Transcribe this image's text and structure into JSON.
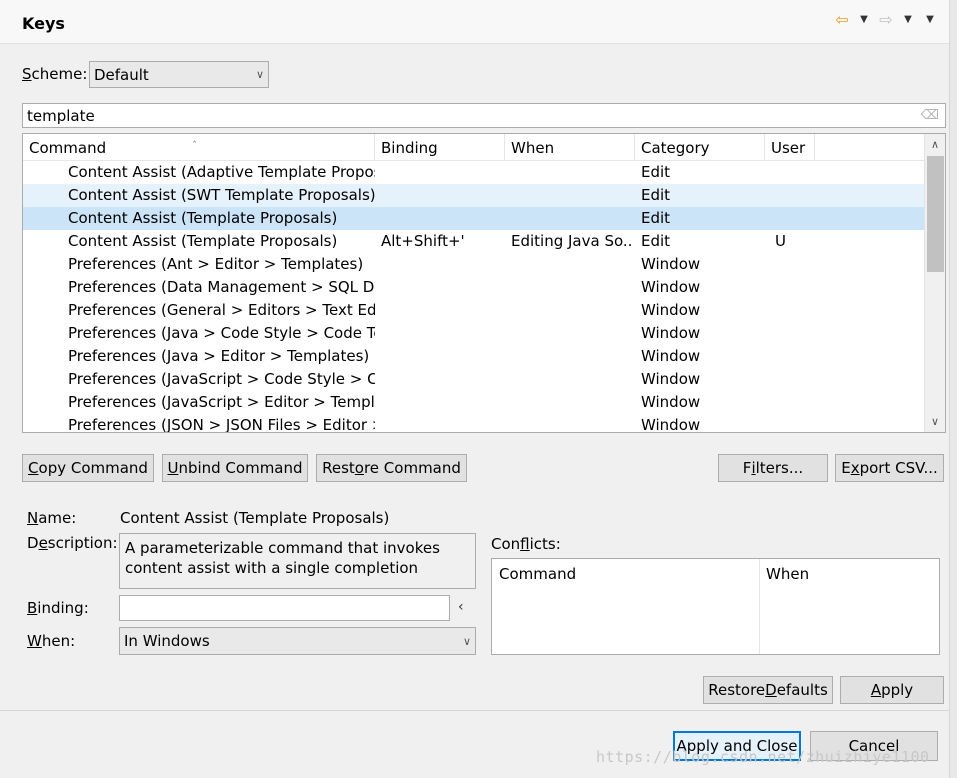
{
  "header": {
    "title": "Keys"
  },
  "nav": {
    "back": "⇦",
    "forward": "⇨",
    "dropdown": "▼",
    "menu": "▼"
  },
  "scheme": {
    "label_pre": "",
    "label_u": "S",
    "label_post": "cheme:",
    "value": "Default"
  },
  "filter": {
    "value": "template",
    "clear_icon": "⌫"
  },
  "table": {
    "columns": [
      "Command",
      "Binding",
      "When",
      "Category",
      "User"
    ],
    "rows": [
      {
        "command": "Content Assist (Adaptive Template Proposals)",
        "binding": "",
        "when": "",
        "category": "Edit",
        "user": ""
      },
      {
        "command": "Content Assist (SWT Template Proposals)",
        "binding": "",
        "when": "",
        "category": "Edit",
        "user": ""
      },
      {
        "command": "Content Assist (Template Proposals)",
        "binding": "",
        "when": "",
        "category": "Edit",
        "user": ""
      },
      {
        "command": "Content Assist (Template Proposals)",
        "binding": "Alt+Shift+'",
        "when": "Editing Java So...",
        "category": "Edit",
        "user": "U"
      },
      {
        "command": "Preferences (Ant > Editor > Templates)",
        "binding": "",
        "when": "",
        "category": "Window",
        "user": ""
      },
      {
        "command": "Preferences (Data Management > SQL Development)",
        "binding": "",
        "when": "",
        "category": "Window",
        "user": ""
      },
      {
        "command": "Preferences (General > Editors > Text Editors)",
        "binding": "",
        "when": "",
        "category": "Window",
        "user": ""
      },
      {
        "command": "Preferences (Java > Code Style > Code Templates)",
        "binding": "",
        "when": "",
        "category": "Window",
        "user": ""
      },
      {
        "command": "Preferences (Java > Editor > Templates)",
        "binding": "",
        "when": "",
        "category": "Window",
        "user": ""
      },
      {
        "command": "Preferences (JavaScript > Code Style > Code Templates)",
        "binding": "",
        "when": "",
        "category": "Window",
        "user": ""
      },
      {
        "command": "Preferences (JavaScript > Editor > Templates)",
        "binding": "",
        "when": "",
        "category": "Window",
        "user": ""
      },
      {
        "command": "Preferences (JSON > JSON Files > Editor > Templates)",
        "binding": "",
        "when": "",
        "category": "Window",
        "user": ""
      }
    ]
  },
  "buttons": {
    "copy_u": "C",
    "copy_rest": "opy Command",
    "unbind_u": "U",
    "unbind_rest": "nbind Command",
    "restore_pre": "Rest",
    "restore_u": "o",
    "restore_post": "re Command",
    "filters_pre": "F",
    "filters_u": "i",
    "filters_post": "lters...",
    "export_pre": "E",
    "export_u": "x",
    "export_post": "port CSV...",
    "restore_defaults_pre": "Restore ",
    "restore_defaults_u": "D",
    "restore_defaults_post": "efaults",
    "apply_u": "A",
    "apply_rest": "pply",
    "apply_close": "Apply and Close",
    "cancel": "Cancel"
  },
  "details": {
    "name_u": "N",
    "name_rest": "ame:",
    "name_value": "Content Assist (Template Proposals)",
    "desc_pre": "D",
    "desc_u": "e",
    "desc_post": "scription:",
    "desc_value": "A parameterizable command that invokes content assist with a single completion",
    "binding_u": "B",
    "binding_rest": "inding:",
    "binding_value": "",
    "binding_arrow": "‹",
    "when_u": "W",
    "when_rest": "hen:",
    "when_value": "In Windows"
  },
  "conflicts": {
    "label_pre": "Con",
    "label_u": "f",
    "label_post": "licts:",
    "columns": [
      "Command",
      "When"
    ]
  },
  "watermark": "https://blog.csdn.net/zhuizhiye1100"
}
